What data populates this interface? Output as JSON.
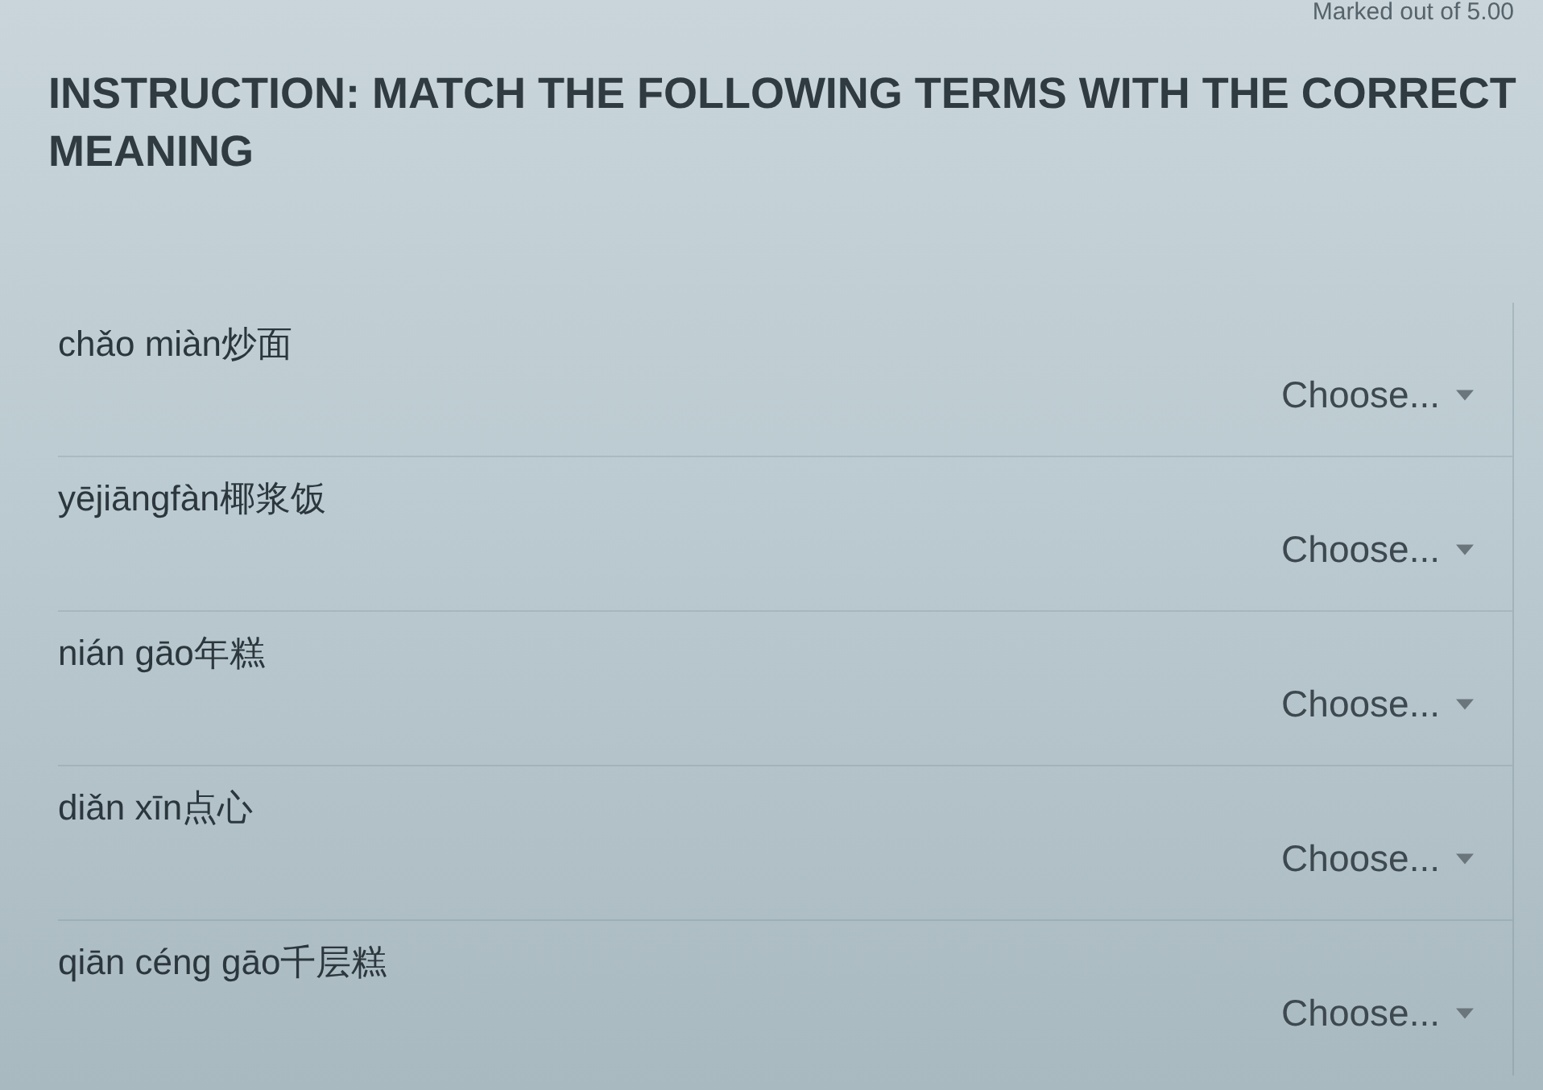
{
  "grade": "Marked out of 5.00",
  "instruction": "INSTRUCTION: MATCH THE FOLLOWING TERMS WITH THE CORRECT MEANING",
  "items": [
    {
      "term": "chǎo miàn炒面",
      "choice": "Choose..."
    },
    {
      "term": "yējiāngfàn椰浆饭",
      "choice": "Choose..."
    },
    {
      "term": "nián gāo年糕",
      "choice": "Choose..."
    },
    {
      "term": "diǎn xīn点心",
      "choice": "Choose..."
    },
    {
      "term": "qiān céng gāo千层糕",
      "choice": "Choose..."
    }
  ]
}
